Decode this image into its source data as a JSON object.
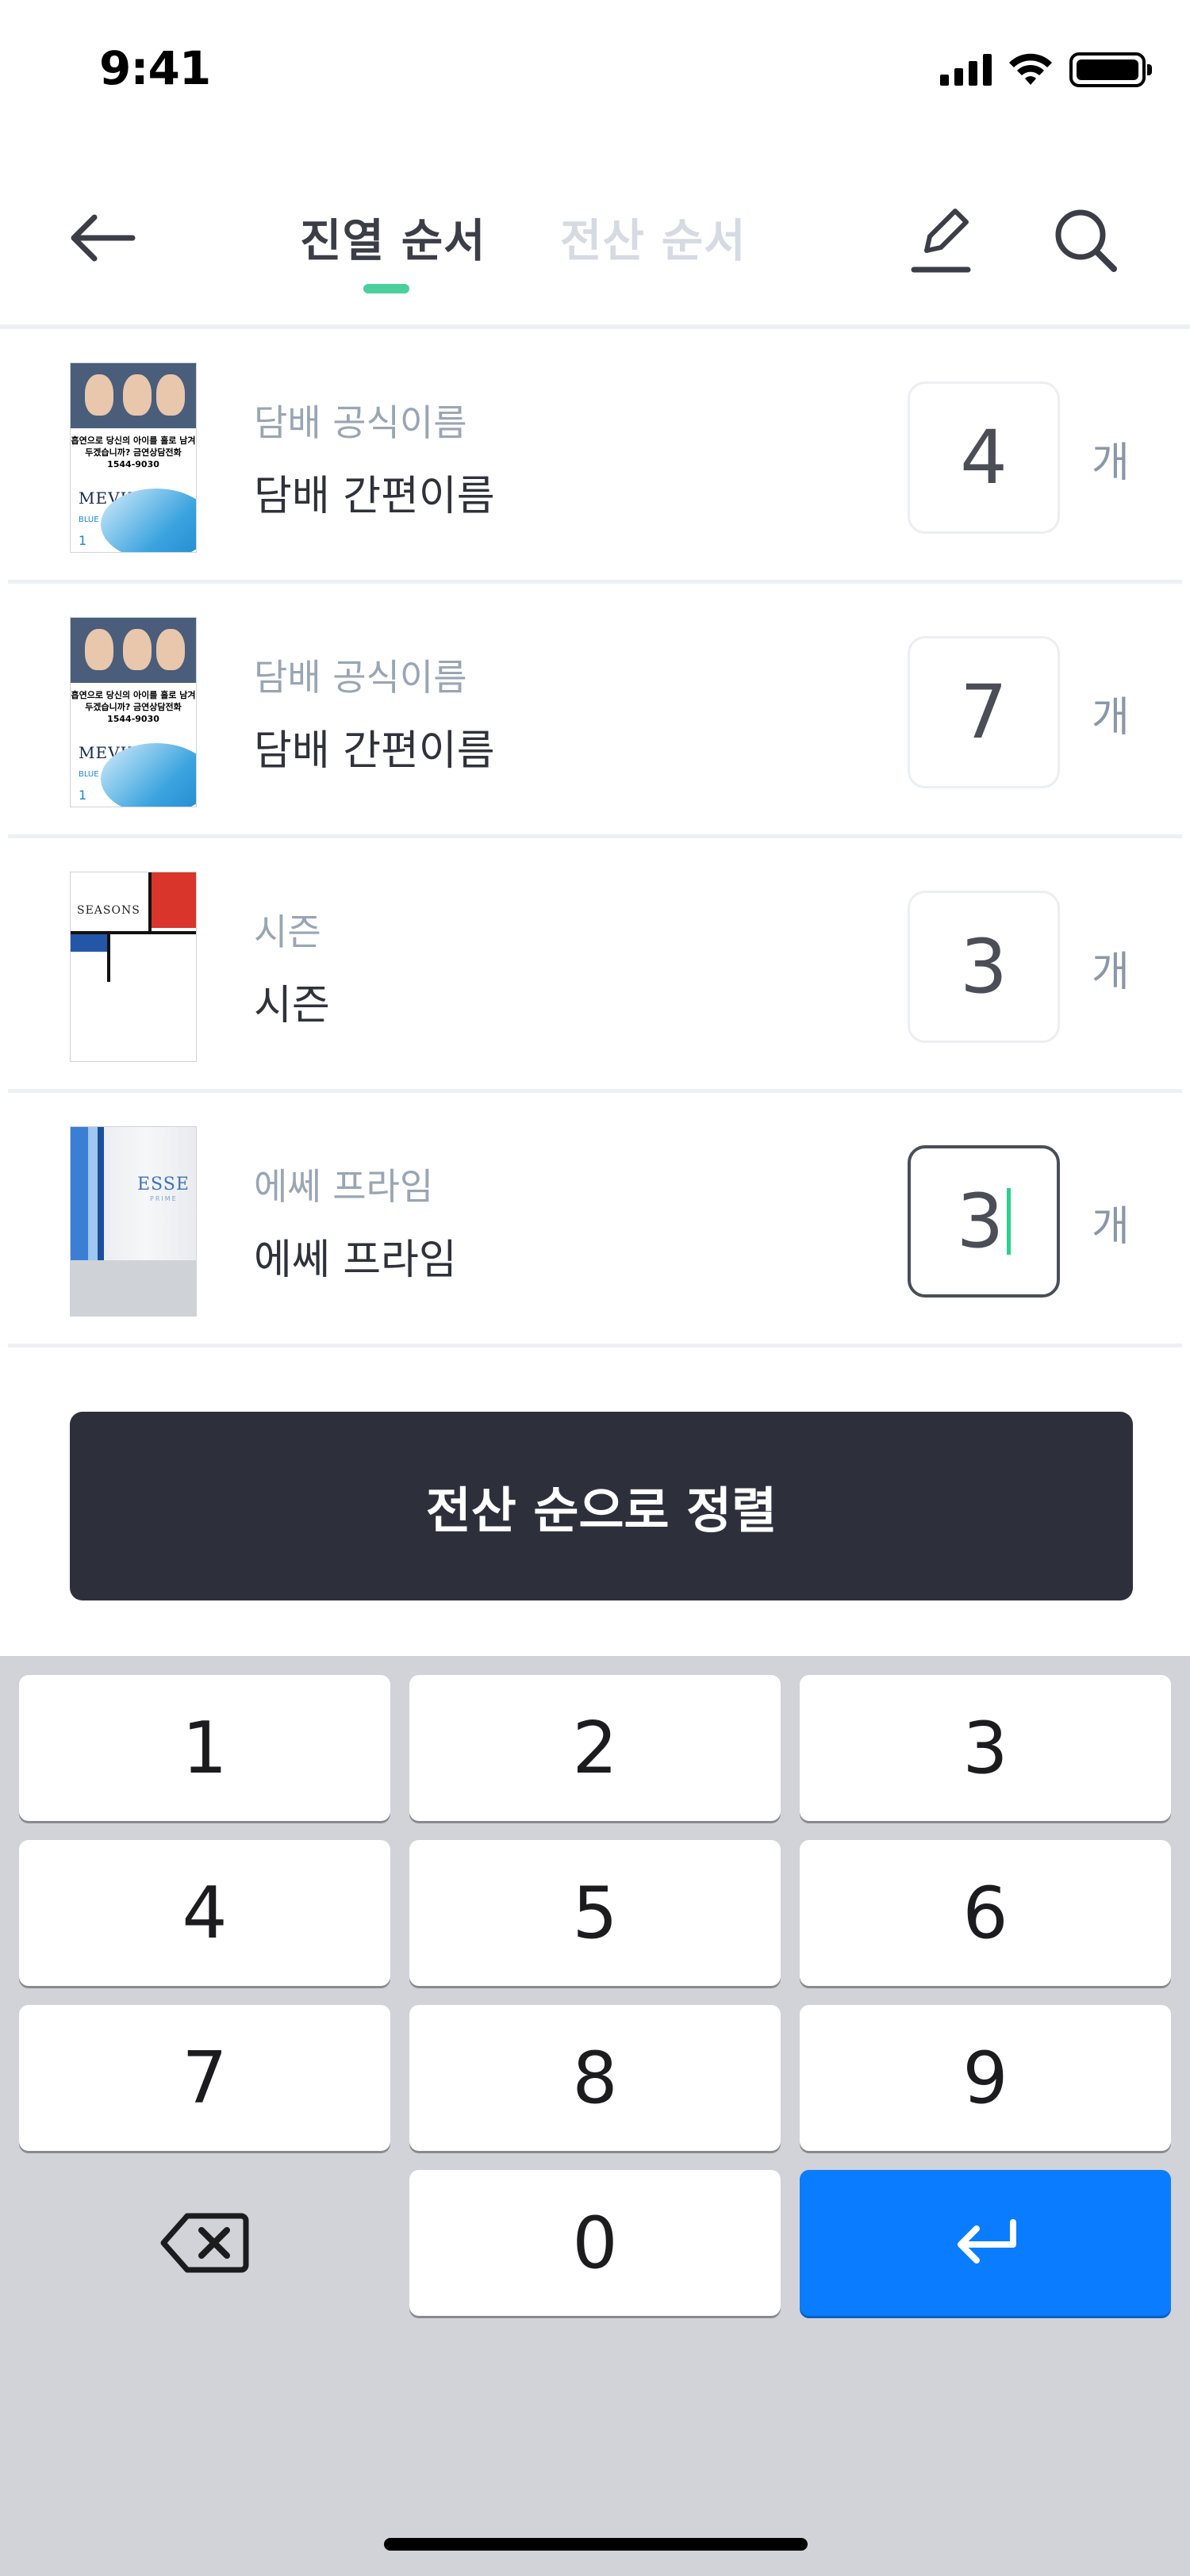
{
  "status_bar": {
    "time": "9:41"
  },
  "header": {
    "tab_active": "진열 순서",
    "tab_inactive": "전산 순서"
  },
  "items": [
    {
      "official_name": "담배 공식이름",
      "short_name": "담배 간편이름",
      "qty": "4",
      "unit": "개",
      "pack": "mevius"
    },
    {
      "official_name": "담배 공식이름",
      "short_name": "담배 간편이름",
      "qty": "7",
      "unit": "개",
      "pack": "mevius"
    },
    {
      "official_name": "시즌",
      "short_name": "시즌",
      "qty": "3",
      "unit": "개",
      "pack": "seasons"
    },
    {
      "official_name": "에쎄 프라임",
      "short_name": "에쎄 프라임",
      "qty": "3",
      "unit": "개",
      "pack": "esse",
      "focused": true
    }
  ],
  "pack_text": {
    "mevius_warning": "흡연으로 당신의 아이를 홀로 남겨두겠습니까? 금연상담전화 1544-9030",
    "mevius_brand": "MEVIUS",
    "mevius_blue": "BLUE",
    "mevius_one": "1",
    "seasons_brand": "SEASONS",
    "esse_brand": "ESSE",
    "esse_sub": "PRIME"
  },
  "sort_button": {
    "label": "전산 순으로 정렬"
  },
  "keypad": {
    "keys": [
      "1",
      "2",
      "3",
      "4",
      "5",
      "6",
      "7",
      "8",
      "9",
      "0"
    ]
  },
  "colors": {
    "accent": "#4ad19b",
    "button_dark": "#2d303b",
    "enter_key": "#0a7cff"
  }
}
